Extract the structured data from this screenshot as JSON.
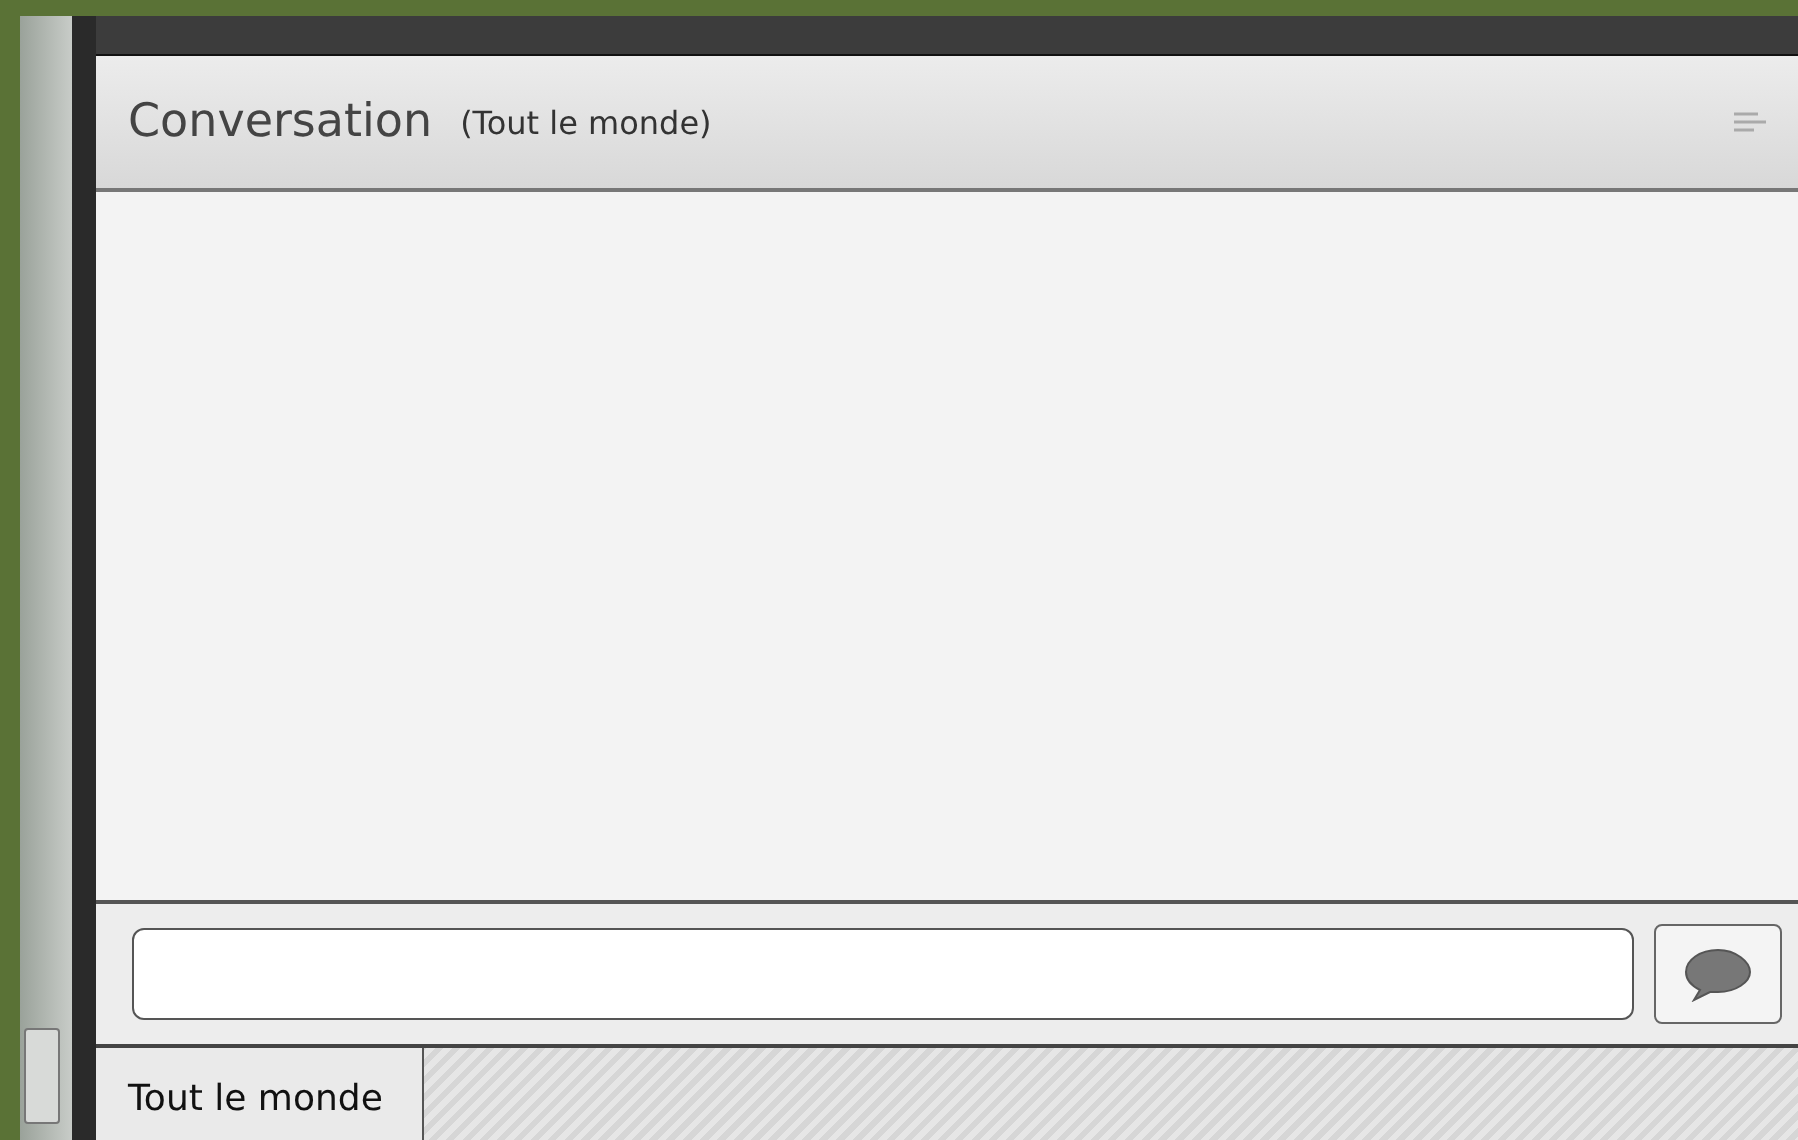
{
  "panel": {
    "title": "Conversation",
    "scope": "(Tout le monde)"
  },
  "tabs": [
    {
      "label": "Tout le monde",
      "selected": true
    }
  ]
}
